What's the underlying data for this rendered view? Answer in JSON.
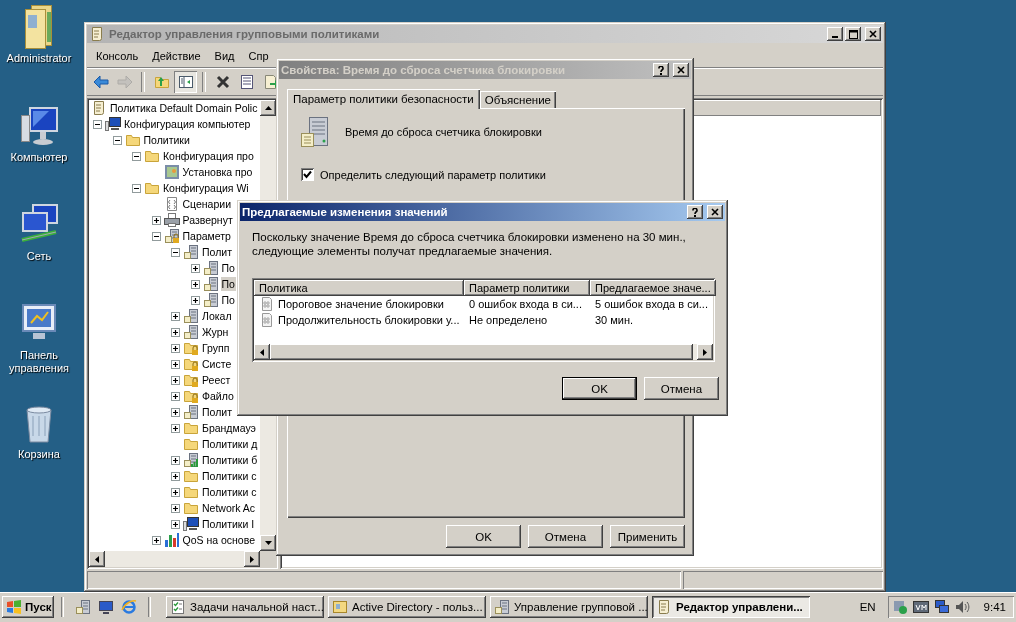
{
  "desktop_icons": [
    {
      "label": "Administrator",
      "kind": "user-folder"
    },
    {
      "label": "Компьютер",
      "kind": "computer"
    },
    {
      "label": "Сеть",
      "kind": "network"
    },
    {
      "label": "Панель управления",
      "kind": "control-panel"
    },
    {
      "label": "Корзина",
      "kind": "recycle-bin"
    }
  ],
  "main_window": {
    "title": "Редактор управления групповыми политиками",
    "menu": [
      "Консоль",
      "Действие",
      "Вид",
      "Спр"
    ],
    "toolbar_groups": [
      {
        "buttons": [
          {
            "kind": "back",
            "disabled": false,
            "pressed": false
          },
          {
            "kind": "forward",
            "disabled": true,
            "pressed": false
          }
        ]
      },
      {
        "buttons": [
          {
            "kind": "up",
            "disabled": false,
            "pressed": false
          },
          {
            "kind": "tree-toggle",
            "disabled": false,
            "pressed": true
          }
        ]
      },
      {
        "buttons": [
          {
            "kind": "delete",
            "disabled": false,
            "pressed": false
          },
          {
            "kind": "properties",
            "disabled": false,
            "pressed": false
          },
          {
            "kind": "export",
            "disabled": false,
            "pressed": false
          }
        ]
      }
    ],
    "tree": {
      "label": "Политика Default Domain Polic",
      "kind": "scroll",
      "selected": false,
      "children": [
        {
          "label": "Конфигурация компьютер",
          "kind": "computer",
          "expandable": true,
          "expanded": true,
          "selected": false,
          "children": [
            {
              "label": "Политики",
              "kind": "folder",
              "expandable": true,
              "expanded": true,
              "selected": false,
              "children": [
                {
                  "label": "Конфигурация про",
                  "kind": "folder",
                  "expandable": true,
                  "expanded": true,
                  "selected": false,
                  "children": [
                    {
                      "label": "Установка про",
                      "kind": "package",
                      "expandable": false,
                      "expanded": false,
                      "selected": false
                    }
                  ]
                },
                {
                  "label": "Конфигурация Wi",
                  "kind": "folder",
                  "expandable": true,
                  "expanded": true,
                  "selected": false,
                  "children": [
                    {
                      "label": "Сценарии",
                      "kind": "script",
                      "expandable": false,
                      "expanded": false,
                      "selected": false
                    },
                    {
                      "label": "Развернут",
                      "kind": "printer",
                      "expandable": true,
                      "expanded": false,
                      "selected": false
                    },
                    {
                      "label": "Параметр",
                      "kind": "server-lock",
                      "expandable": true,
                      "expanded": true,
                      "selected": false,
                      "children": [
                        {
                          "label": "Полит",
                          "kind": "server",
                          "expandable": true,
                          "expanded": true,
                          "selected": false,
                          "children": [
                            {
                              "label": "По",
                              "kind": "server",
                              "expandable": true,
                              "expanded": false,
                              "selected": false
                            },
                            {
                              "label": "По",
                              "kind": "server",
                              "expandable": true,
                              "expanded": false,
                              "selected": true
                            },
                            {
                              "label": "По",
                              "kind": "server",
                              "expandable": true,
                              "expanded": false,
                              "selected": false
                            }
                          ]
                        },
                        {
                          "label": "Локал",
                          "kind": "server",
                          "expandable": true,
                          "expanded": false,
                          "selected": false
                        },
                        {
                          "label": "Журн",
                          "kind": "server",
                          "expandable": true,
                          "expanded": false,
                          "selected": false
                        },
                        {
                          "label": "Групп",
                          "kind": "folder-lock",
                          "expandable": true,
                          "expanded": false,
                          "selected": false
                        },
                        {
                          "label": "Систе",
                          "kind": "folder-lock",
                          "expandable": true,
                          "expanded": false,
                          "selected": false
                        },
                        {
                          "label": "Реест",
                          "kind": "folder-lock",
                          "expandable": true,
                          "expanded": false,
                          "selected": false
                        },
                        {
                          "label": "Файло",
                          "kind": "folder-lock",
                          "expandable": true,
                          "expanded": false,
                          "selected": false
                        },
                        {
                          "label": "Полит",
                          "kind": "server",
                          "expandable": true,
                          "expanded": false,
                          "selected": false
                        },
                        {
                          "label": "Брандмауэ",
                          "kind": "folder",
                          "expandable": true,
                          "expanded": false,
                          "selected": false
                        },
                        {
                          "label": "Политики д",
                          "kind": "folder",
                          "expandable": false,
                          "expanded": false,
                          "selected": false
                        },
                        {
                          "label": "Политики б",
                          "kind": "chart",
                          "expandable": true,
                          "expanded": false,
                          "selected": false
                        },
                        {
                          "label": "Политики с",
                          "kind": "folder",
                          "expandable": true,
                          "expanded": false,
                          "selected": false
                        },
                        {
                          "label": "Политики с",
                          "kind": "folder",
                          "expandable": true,
                          "expanded": false,
                          "selected": false
                        },
                        {
                          "label": "Network Ac",
                          "kind": "folder",
                          "expandable": true,
                          "expanded": false,
                          "selected": false
                        },
                        {
                          "label": "Политики I",
                          "kind": "computer",
                          "expandable": true,
                          "expanded": false,
                          "selected": false
                        }
                      ]
                    },
                    {
                      "label": "QoS на основе",
                      "kind": "bars",
                      "expandable": true,
                      "expanded": false,
                      "selected": false
                    }
                  ]
                }
              ]
            }
          ]
        }
      ]
    }
  },
  "properties_dialog": {
    "title": "Свойства: Время до сброса счетчика блокировки",
    "tabs": [
      {
        "label": "Параметр политики безопасности",
        "selected": true
      },
      {
        "label": "Объяснение",
        "selected": false
      }
    ],
    "policy_name": "Время до сброса счетчика блокировки",
    "define_policy": {
      "label": "Определить следующий параметр политики",
      "checked": true
    },
    "buttons": [
      "OK",
      "Отмена",
      "Применить"
    ]
  },
  "suggestion_dialog": {
    "title": "Предлагаемые изменения значений",
    "message": "Поскольку значение Время до сброса счетчика блокировки изменено на 30 мин.,\nследующие элементы получат предлагаемые значения.",
    "columns": [
      "Политика",
      "Параметр политики",
      "Предлагаемое значе..."
    ],
    "rows": [
      [
        "Пороговое значение блокировки",
        "0 ошибок входа в си...",
        "5 ошибок входа в си..."
      ],
      [
        "Продолжительность блокировки у...",
        "Не определено",
        "30 мин."
      ]
    ],
    "buttons": [
      {
        "label": "OK",
        "default": true
      },
      {
        "label": "Отмена",
        "default": false
      }
    ]
  },
  "taskbar": {
    "start": "Пуск",
    "tasks": [
      {
        "label": "Задачи начальной наст...",
        "kind": "tasks",
        "selected": false
      },
      {
        "label": "Active Directory - польз...",
        "kind": "directory",
        "selected": false
      },
      {
        "label": "Управление групповой ...",
        "kind": "gpm",
        "selected": false
      },
      {
        "label": "Редактор управлени...",
        "kind": "editor",
        "selected": true
      }
    ],
    "language": "EN",
    "clock": "9:41"
  }
}
